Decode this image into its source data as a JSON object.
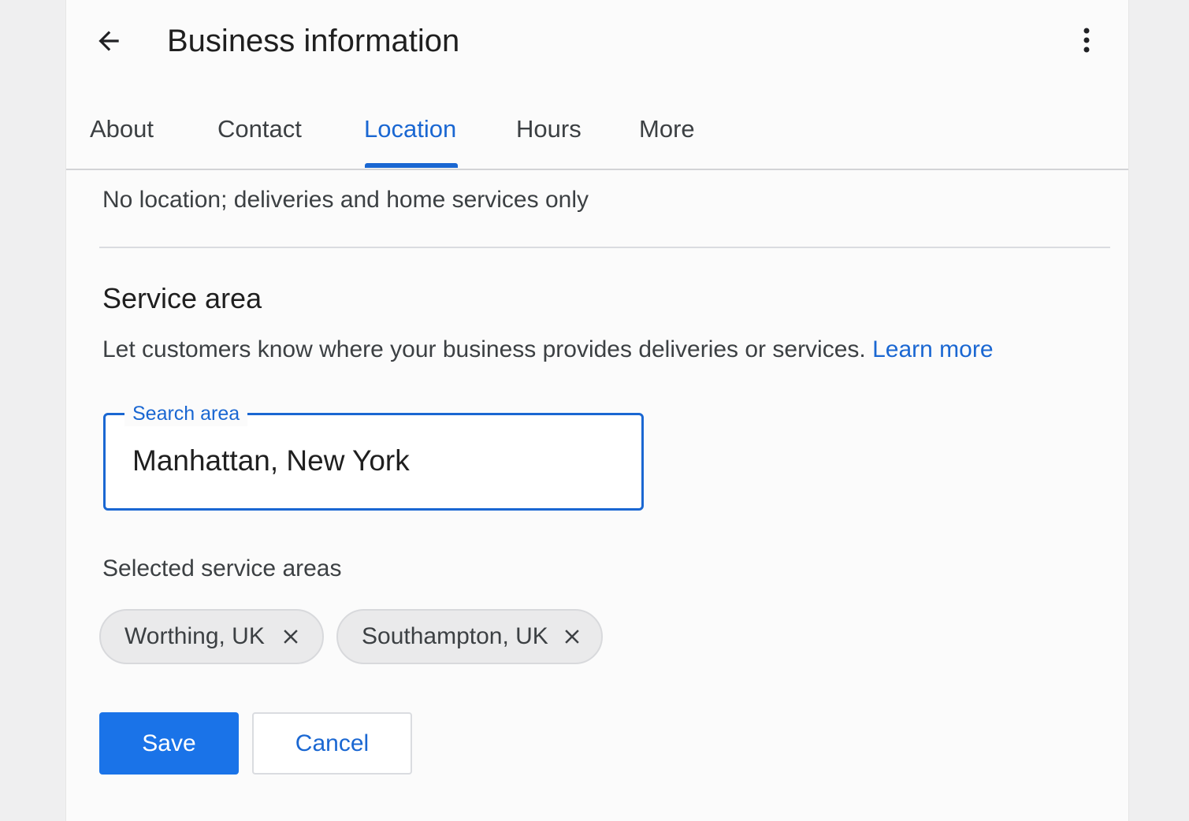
{
  "header": {
    "title": "Business information",
    "back_icon": "arrow-back-icon",
    "more_icon": "more-vert-icon"
  },
  "tabs": [
    {
      "label": "About",
      "active": false
    },
    {
      "label": "Contact",
      "active": false
    },
    {
      "label": "Location",
      "active": true
    },
    {
      "label": "Hours",
      "active": false
    },
    {
      "label": "More",
      "active": false
    }
  ],
  "location_option": "No location; deliveries and home services only",
  "service_area": {
    "title": "Service area",
    "description": "Let customers know where your business provides deliveries or services.",
    "learn_more": "Learn more",
    "search": {
      "label": "Search area",
      "value": "Manhattan, New York"
    },
    "selected_label": "Selected service areas",
    "selected_areas": [
      {
        "label": "Worthing, UK",
        "remove_icon": "close-icon"
      },
      {
        "label": "Southampton, UK",
        "remove_icon": "close-icon"
      }
    ]
  },
  "actions": {
    "save": "Save",
    "cancel": "Cancel"
  },
  "colors": {
    "accent": "#1a73e8",
    "link": "#1a67d2",
    "background": "#efeff0",
    "panel": "#fbfbfb",
    "chip": "#eaeaeb"
  }
}
